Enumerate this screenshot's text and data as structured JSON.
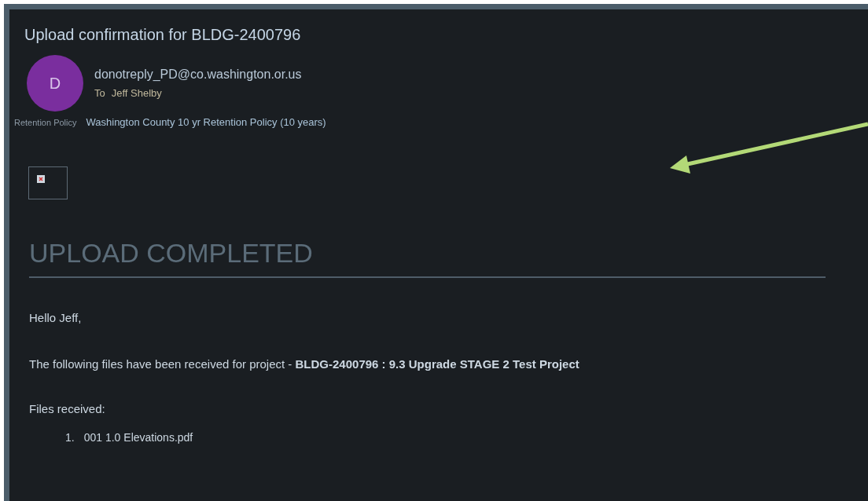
{
  "subject": "Upload confirmation for BLDG-2400796",
  "sender": {
    "avatar_letter": "D",
    "address": "donotreply_PD@co.washington.or.us",
    "to_label": "To",
    "to": "Jeff Shelby"
  },
  "retention": {
    "label": "Retention Policy",
    "value": "Washington County 10 yr Retention Policy (10 years)"
  },
  "body": {
    "heading": "UPLOAD COMPLETED",
    "greeting": "Hello Jeff,",
    "message": "The following files have been received for project - **BLDG-2400796 : 9.3 Upgrade STAGE 2 Test Project**",
    "files_label": "Files received:",
    "files": [
      {
        "number": "1.",
        "name": "001 1.0 Elevations.pdf"
      }
    ]
  }
}
